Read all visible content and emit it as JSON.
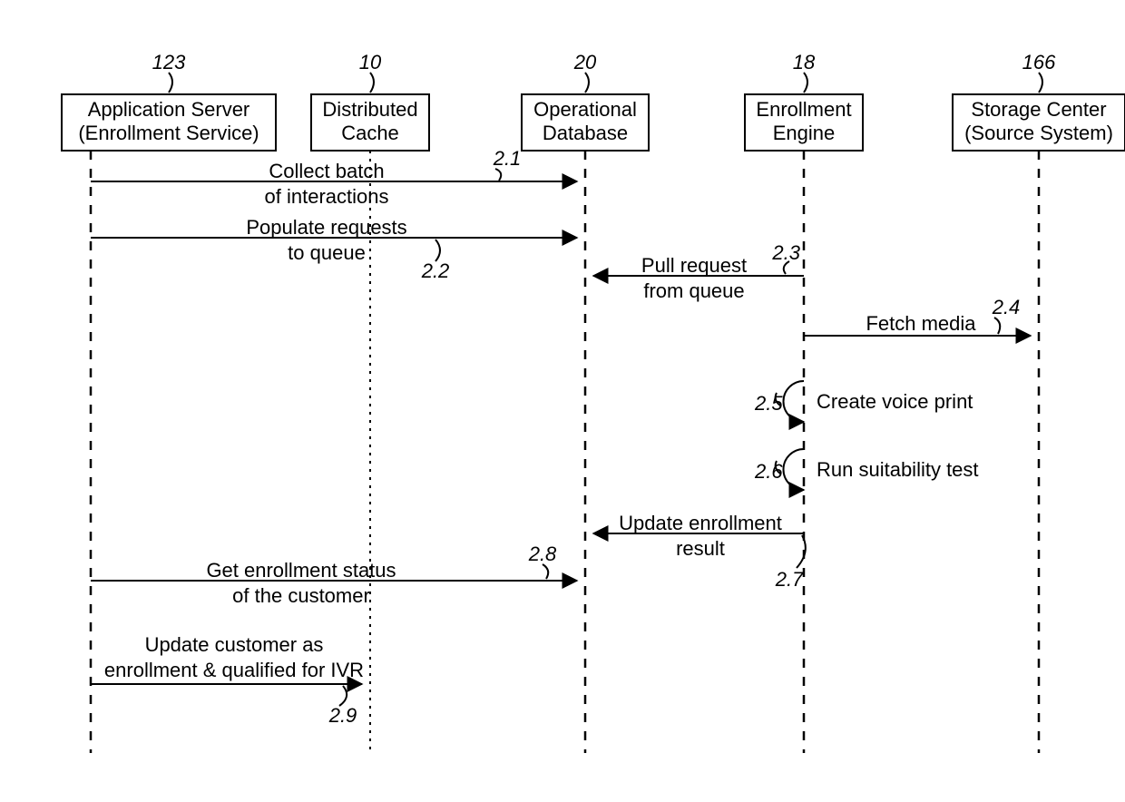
{
  "participants": {
    "p1": {
      "label1": "Application Server",
      "label2": "(Enrollment Service)",
      "ref": "123"
    },
    "p2": {
      "label1": "Distributed",
      "label2": "Cache",
      "ref": "10"
    },
    "p3": {
      "label1": "Operational",
      "label2": "Database",
      "ref": "20"
    },
    "p4": {
      "label1": "Enrollment",
      "label2": "Engine",
      "ref": "18"
    },
    "p5": {
      "label1": "Storage Center",
      "label2": "(Source System)",
      "ref": "166"
    }
  },
  "messages": {
    "m1": {
      "line1": "Collect batch",
      "line2": "of interactions",
      "ref": "2.1"
    },
    "m2": {
      "line1": "Populate requests",
      "line2": "to queue",
      "ref": "2.2"
    },
    "m3": {
      "line1": "Pull request",
      "line2": "from queue",
      "ref": "2.3"
    },
    "m4": {
      "line1": "Fetch media",
      "ref": "2.4"
    },
    "m5": {
      "line1": "Create voice print",
      "ref": "2.5"
    },
    "m6": {
      "line1": "Run suitability test",
      "ref": "2.6"
    },
    "m7": {
      "line1": "Update enrollment",
      "line2": "result",
      "ref": "2.7"
    },
    "m8": {
      "line1": "Get enrollment status",
      "line2": "of the customer",
      "ref": "2.8"
    },
    "m9": {
      "line1": "Update customer as",
      "line2": "enrollment & qualified for IVR",
      "ref": "2.9"
    }
  }
}
